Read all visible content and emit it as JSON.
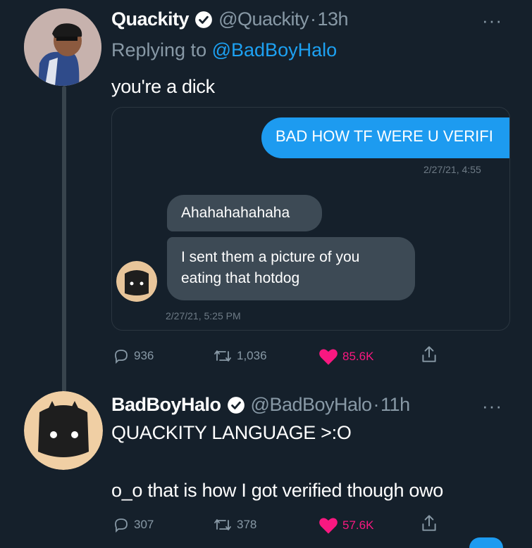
{
  "tweet1": {
    "display_name": "Quackity",
    "handle": "@Quackity",
    "separator": "·",
    "time": "13h",
    "replying_prefix": "Replying to",
    "replying_to": "@BadBoyHalo",
    "text": "you're a dick",
    "media": {
      "outgoing_message": "BAD HOW TF WERE U VERIFI",
      "outgoing_timestamp": "2/27/21, 4:55",
      "incoming_messages": [
        "Ahahahahahaha",
        "I sent them a picture of you",
        "eating that hotdog"
      ],
      "incoming_timestamp": "2/27/21, 5:25 PM"
    },
    "stats": {
      "replies": "936",
      "retweets": "1,036",
      "likes": "85.6K"
    }
  },
  "tweet2": {
    "display_name": "BadBoyHalo",
    "handle": "@BadBoyHalo",
    "separator": "·",
    "time": "11h",
    "text_line1": "QUACKITY LANGUAGE >:O",
    "text_line2": "o_o that is how I got verified though owo",
    "stats": {
      "replies": "307",
      "retweets": "378",
      "likes": "57.6K"
    }
  },
  "colors": {
    "background": "#15202b",
    "accent": "#1da1f2",
    "like": "#f91880",
    "muted": "#8899a6",
    "bubble_incoming": "#3d4a55"
  },
  "icons": [
    "verified-badge-icon",
    "more-options-icon",
    "reply-icon",
    "retweet-icon",
    "heart-icon",
    "share-icon"
  ]
}
